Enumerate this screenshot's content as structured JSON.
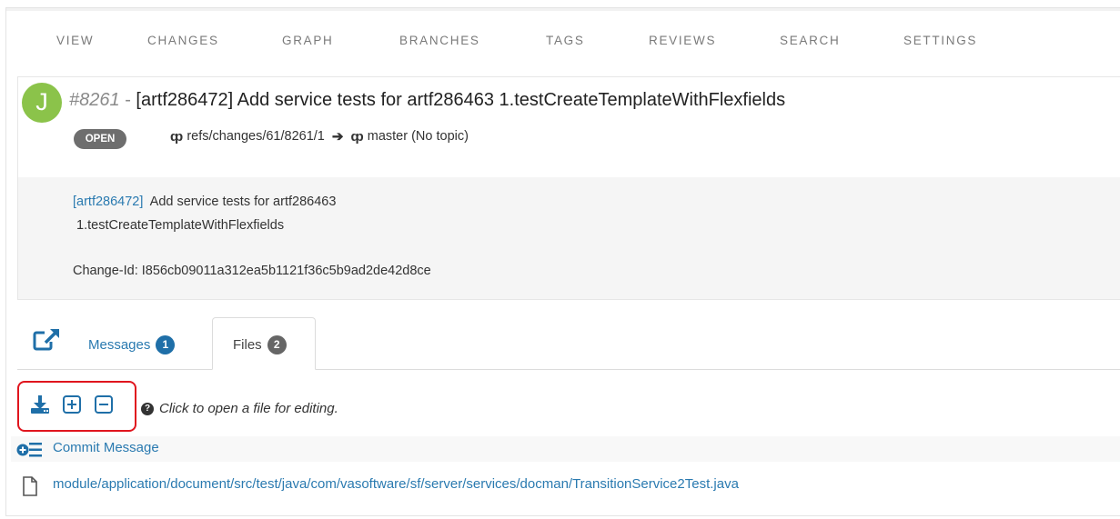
{
  "nav": {
    "items": [
      "VIEW",
      "CHANGES",
      "GRAPH",
      "BRANCHES",
      "TAGS",
      "REVIEWS",
      "SEARCH",
      "SETTINGS"
    ]
  },
  "change": {
    "avatar_letter": "J",
    "avatar_color": "#8bc34a",
    "number": "#8261",
    "separator": "-",
    "title": "[artf286472] Add service tests for artf286463 1.testCreateTemplateWithFlexfields",
    "status": "OPEN",
    "source_ref": "refs/changes/61/8261/1",
    "target_ref": "master (No topic)"
  },
  "commit": {
    "artifact_link": "[artf286472]",
    "line1_rest": "  Add service tests for artf286463",
    "line2": " 1.testCreateTemplateWithFlexfields",
    "change_id": "Change-Id: I856cb09011a312ea5b1121f36c5b9ad2de42d8ce"
  },
  "tabs": {
    "messages_label": "Messages",
    "messages_count": "1",
    "files_label": "Files",
    "files_count": "2"
  },
  "toolbar": {
    "hint": "Click to open a file for editing.",
    "highlight_color": "#e0151e"
  },
  "files": {
    "commit_message_label": "Commit Message",
    "file_path": "module/application/document/src/test/java/com/vasoftware/sf/server/services/docman/TransitionService2Test.java"
  },
  "colors": {
    "link": "#2a7ab0",
    "badge_open": "#6e6e6e",
    "messages_count_bg": "#1f6fa8"
  }
}
